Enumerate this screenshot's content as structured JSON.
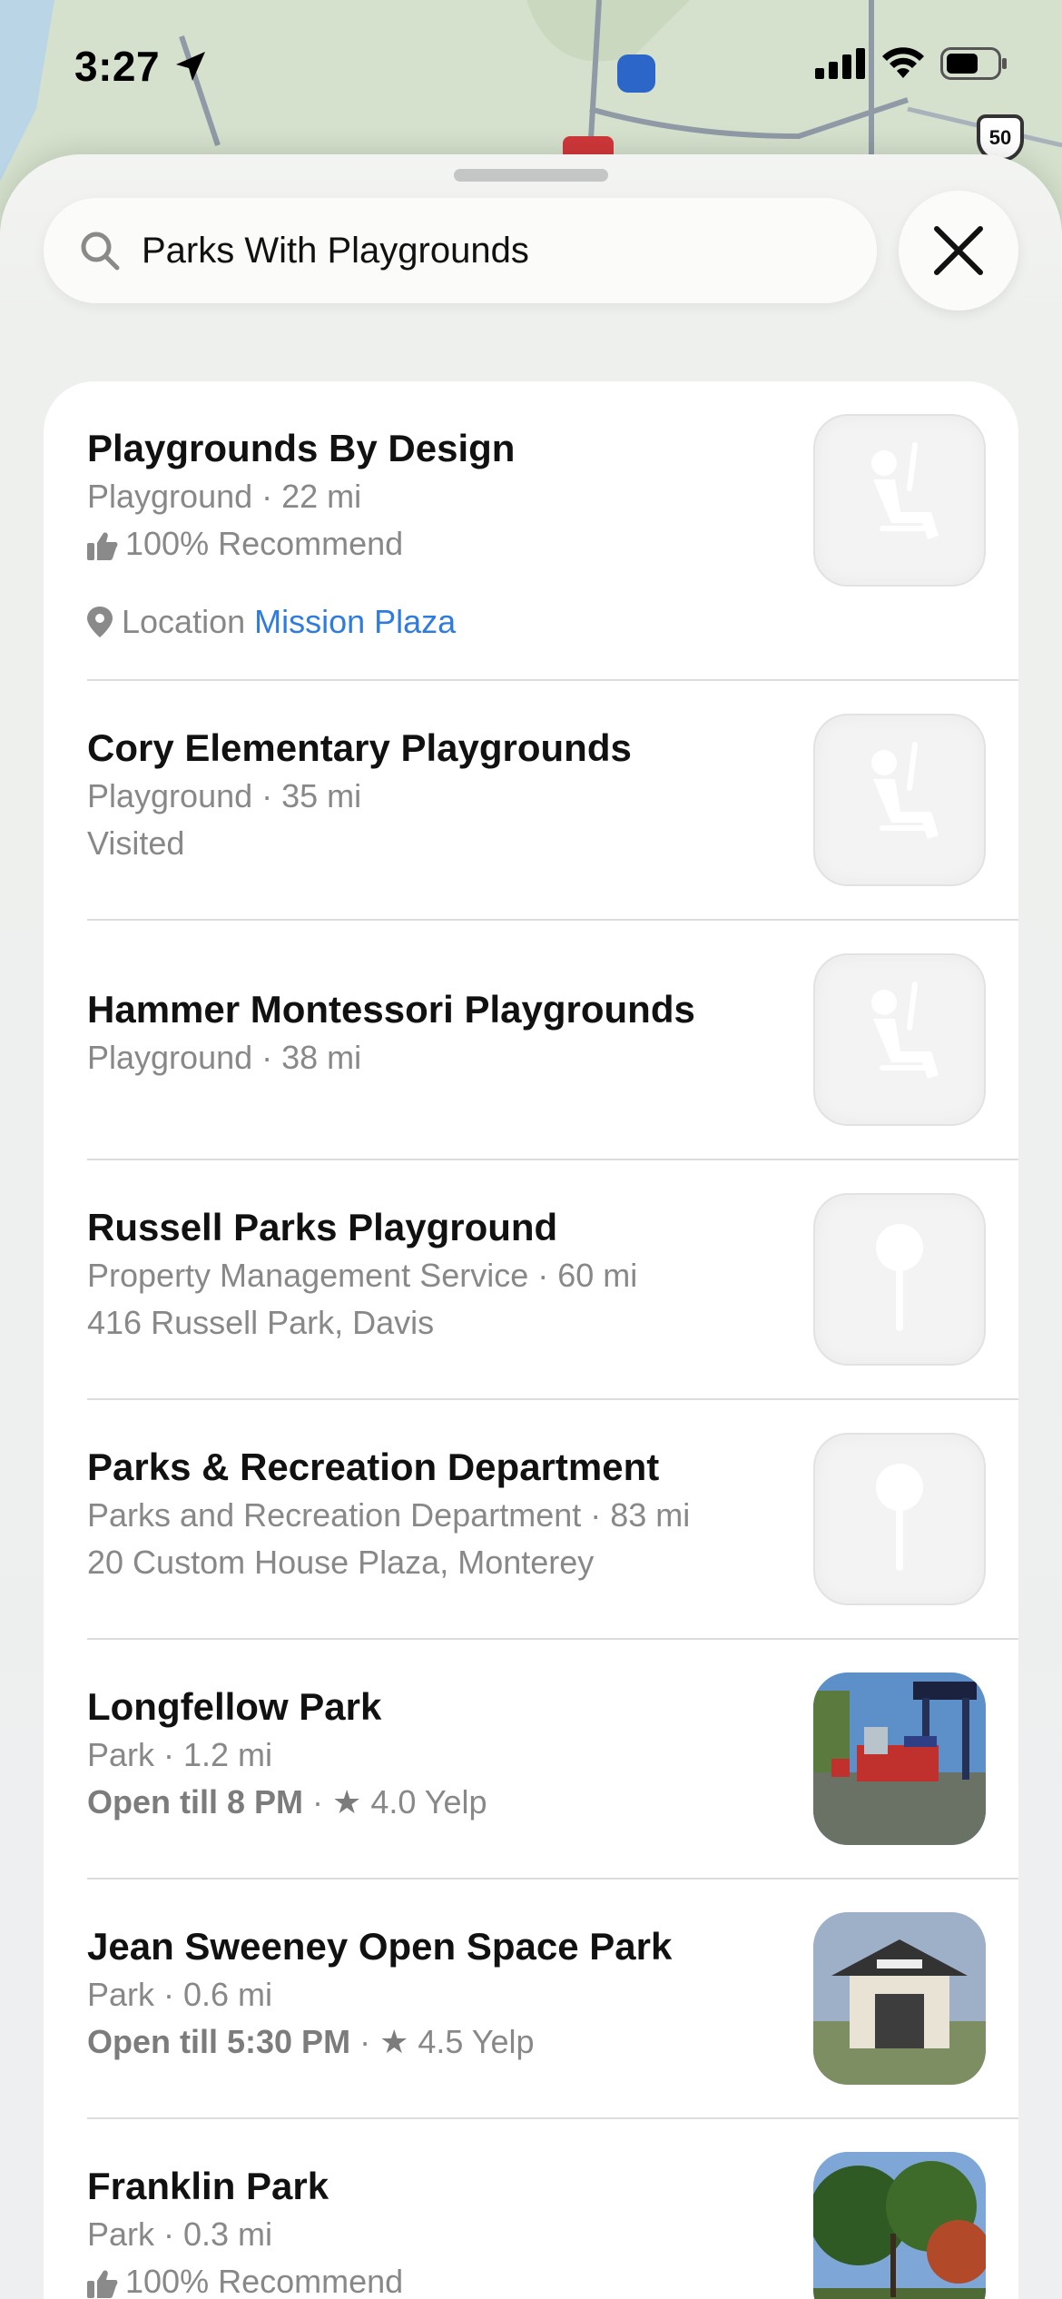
{
  "status_bar": {
    "time": "3:27"
  },
  "map": {
    "shield_label": "50"
  },
  "search": {
    "query": "Parks With Playgrounds"
  },
  "results": [
    {
      "title": "Playgrounds By Design",
      "line1": "Playground · 22 mi",
      "line2": "100% Recommend",
      "location_label": "Location",
      "location_link": "Mission Plaza",
      "thumb": "playground-icon"
    },
    {
      "title": "Cory Elementary Playgrounds",
      "line1": "Playground · 35 mi",
      "line2": "Visited",
      "thumb": "playground-icon"
    },
    {
      "title": "Hammer Montessori Playgrounds",
      "line1": "Playground · 38 mi",
      "thumb": "playground-icon"
    },
    {
      "title": "Russell Parks Playground",
      "line1": "Property Management Service · 60 mi",
      "line2": "416 Russell Park, Davis",
      "thumb": "pin-icon"
    },
    {
      "title": "Parks & Recreation Department",
      "line1": "Parks and Recreation Department · 83 mi",
      "line2": "20 Custom House Plaza, Monterey",
      "thumb": "pin-icon"
    },
    {
      "title": "Longfellow Park",
      "line1": "Park · 1.2 mi",
      "open": "Open till 8 PM",
      "rating": "4.0 Yelp",
      "thumb": "playground-photo"
    },
    {
      "title": "Jean Sweeney Open Space Park",
      "line1": "Park · 0.6 mi",
      "open": "Open till 5:30 PM",
      "rating": "4.5 Yelp",
      "thumb": "gazebo-photo"
    },
    {
      "title": "Franklin Park",
      "line1": "Park · 0.3 mi",
      "line2": "100% Recommend",
      "thumb": "trees-photo"
    }
  ],
  "colors": {
    "link": "#2f7ce0",
    "secondary_text": "#888888",
    "sheet": "#eef0ee"
  }
}
